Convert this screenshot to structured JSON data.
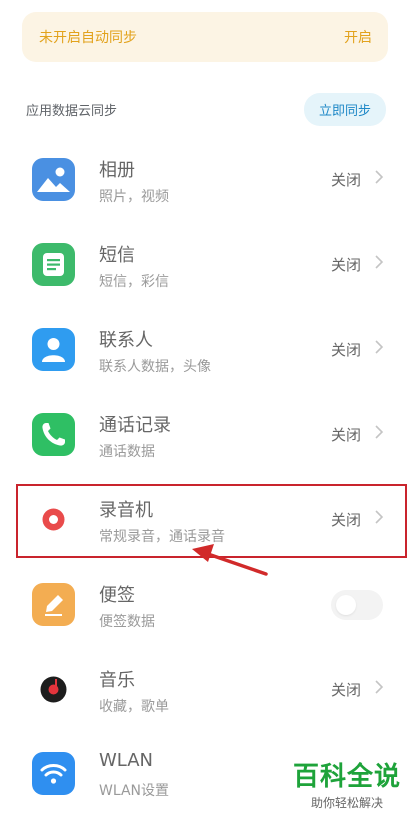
{
  "banner": {
    "text": "未开启自动同步",
    "action": "开启"
  },
  "section": {
    "title": "应用数据云同步",
    "sync_button": "立即同步"
  },
  "items": [
    {
      "title": "相册",
      "subtitle": "照片，视频",
      "status": "关闭",
      "icon": "gallery-icon",
      "color": "#4a90e2"
    },
    {
      "title": "短信",
      "subtitle": "短信，彩信",
      "status": "关闭",
      "icon": "sms-icon",
      "color": "#3dba6b"
    },
    {
      "title": "联系人",
      "subtitle": "联系人数据，头像",
      "status": "关闭",
      "icon": "contacts-icon",
      "color": "#2f9cf0"
    },
    {
      "title": "通话记录",
      "subtitle": "通话数据",
      "status": "关闭",
      "icon": "phone-icon",
      "color": "#2fbf64"
    },
    {
      "title": "录音机",
      "subtitle": "常规录音，通话录音",
      "status": "关闭",
      "icon": "recorder-icon",
      "color": "#e94b4b"
    },
    {
      "title": "便签",
      "subtitle": "便签数据",
      "status": "",
      "toggle": false,
      "icon": "notes-icon",
      "color": "#f3ad52"
    },
    {
      "title": "音乐",
      "subtitle": "收藏，歌单",
      "status": "关闭",
      "icon": "music-icon",
      "color": "#e3343c"
    },
    {
      "title": "WLAN",
      "subtitle": "WLAN设置",
      "status": "",
      "icon": "wifi-icon",
      "color": "#2f8ff0"
    }
  ],
  "annotation": {
    "highlight_color": "#c9242d"
  },
  "watermark": {
    "main": "百科全说",
    "sub": "助你轻松解决"
  }
}
